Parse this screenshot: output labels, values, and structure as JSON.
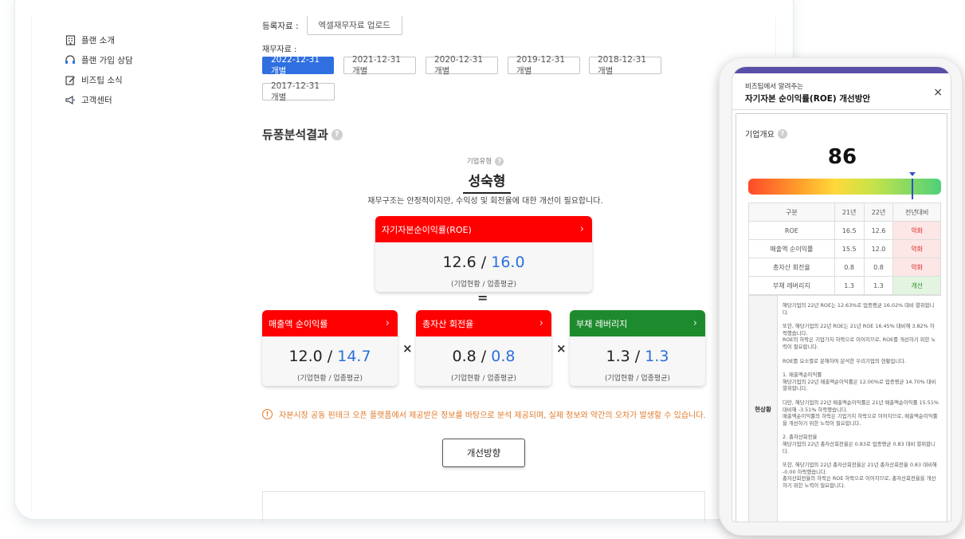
{
  "sidebar": {
    "items": [
      {
        "label": "플랜 소개",
        "icon": "building-icon"
      },
      {
        "label": "플랜 가입 상담",
        "icon": "headset-icon"
      },
      {
        "label": "비즈팁 소식",
        "icon": "edit-icon"
      },
      {
        "label": "고객센터",
        "icon": "megaphone-icon"
      }
    ]
  },
  "registration": {
    "label": "등록자료 :",
    "upload_button": "엑셀재무자료 업로드"
  },
  "financials": {
    "label": "재무자료 :",
    "selected": "2022-12-31 개별",
    "options": [
      "2022-12-31 개별",
      "2021-12-31 개별",
      "2020-12-31 개별",
      "2019-12-31 개별",
      "2018-12-31 개별",
      "2017-12-31 개별"
    ]
  },
  "analysis": {
    "title": "듀퐁분석결과",
    "type_label": "기업유형",
    "type_value": "성숙형",
    "type_desc": "재무구조는 안정적이지만, 수익성 및 회전율에 대한 개선이 필요합니다.",
    "equals": "=",
    "times": "×",
    "roe": {
      "label": "자기자본순이익률(ROE)",
      "company": "12.6",
      "industry": "16.0",
      "sub": "(기업현황 / 업종평균)",
      "color": "#ff0000"
    },
    "metrics": [
      {
        "label": "매출액 순이익률",
        "company": "12.0",
        "industry": "14.7",
        "sub": "(기업현황 / 업종평균)",
        "color": "#ff0000"
      },
      {
        "label": "총자산 회전율",
        "company": "0.8",
        "industry": "0.8",
        "sub": "(기업현황 / 업종평균)",
        "color": "#ff0000"
      },
      {
        "label": "부채 레버리지",
        "company": "1.3",
        "industry": "1.3",
        "sub": "(기업현황 / 업종평균)",
        "color": "#1e8a2e"
      }
    ],
    "notice": "자본시장 공동 핀테크 오픈 플랫폼에서 제공받은 정보를 바탕으로 분석 제공되며, 실제 정보와 약간의 오차가 발생할 수 있습니다.",
    "improve_button": "개선방향"
  },
  "modal": {
    "subtitle": "비즈팁에서 알려주는",
    "title": "자기자본 순이익률(ROE) 개선방안",
    "close": "×",
    "summary_label": "기업개요",
    "score": "86",
    "score_fraction": 0.86,
    "table": {
      "headers": [
        "구분",
        "21년",
        "22년",
        "전년대비"
      ],
      "rows": [
        [
          "ROE",
          "16.5",
          "12.6",
          "악화"
        ],
        [
          "매출액 순이익률",
          "15.5",
          "12.0",
          "악화"
        ],
        [
          "총자산 회전율",
          "0.8",
          "0.8",
          "악화"
        ],
        [
          "부채 레버리지",
          "1.3",
          "1.3",
          "개선"
        ]
      ]
    },
    "status_label": "현상황",
    "paragraphs": [
      "해당기업의 22년 ROE는 12.63%로 업종평균 16.02% 대비 열위합니다.",
      "또한, 해당기업의 22년 ROE는 21년 ROE 16.45% 대비해 3.82% 하락했습니다.\nROE의 하락은 기업가치 하락으로 이어지므로, ROE를 개선하기 위한 노력이 필요합니다.",
      "ROE를 요소별로 분해하여 분석한 우리기업의 현황입니다.",
      "1. 매출액순이익률\n해당기업의 22년 매출액순이익률은 12.00%로 업종평균 14.70% 대비 열위합니다.",
      "다만, 해당기업의 22년 매출액순이익률은 21년 매출액순이익률 15.51% 대비해 -3.51% 하락했습니다.\n매출액순이익률의 하락은 기업가치 하락으로 이어지므로, 매출액순이익률을 개선하기 위한 노력이 필요합니다.",
      "2. 총자산회전율\n해당기업의 22년 총자산회전율은 0.83로 업종평균 0.83 대비 열위합니다.",
      "또한, 해당기업의 22년 총자산회전율은 21년 총자산회전율 0.83 대비해 -0.00 하락했습니다.\n총자산회전율의 하락은 ROE 하락으로 이어지므로, 총자산회전율을 개선하기 위한 노력이 필요합니다."
    ]
  }
}
